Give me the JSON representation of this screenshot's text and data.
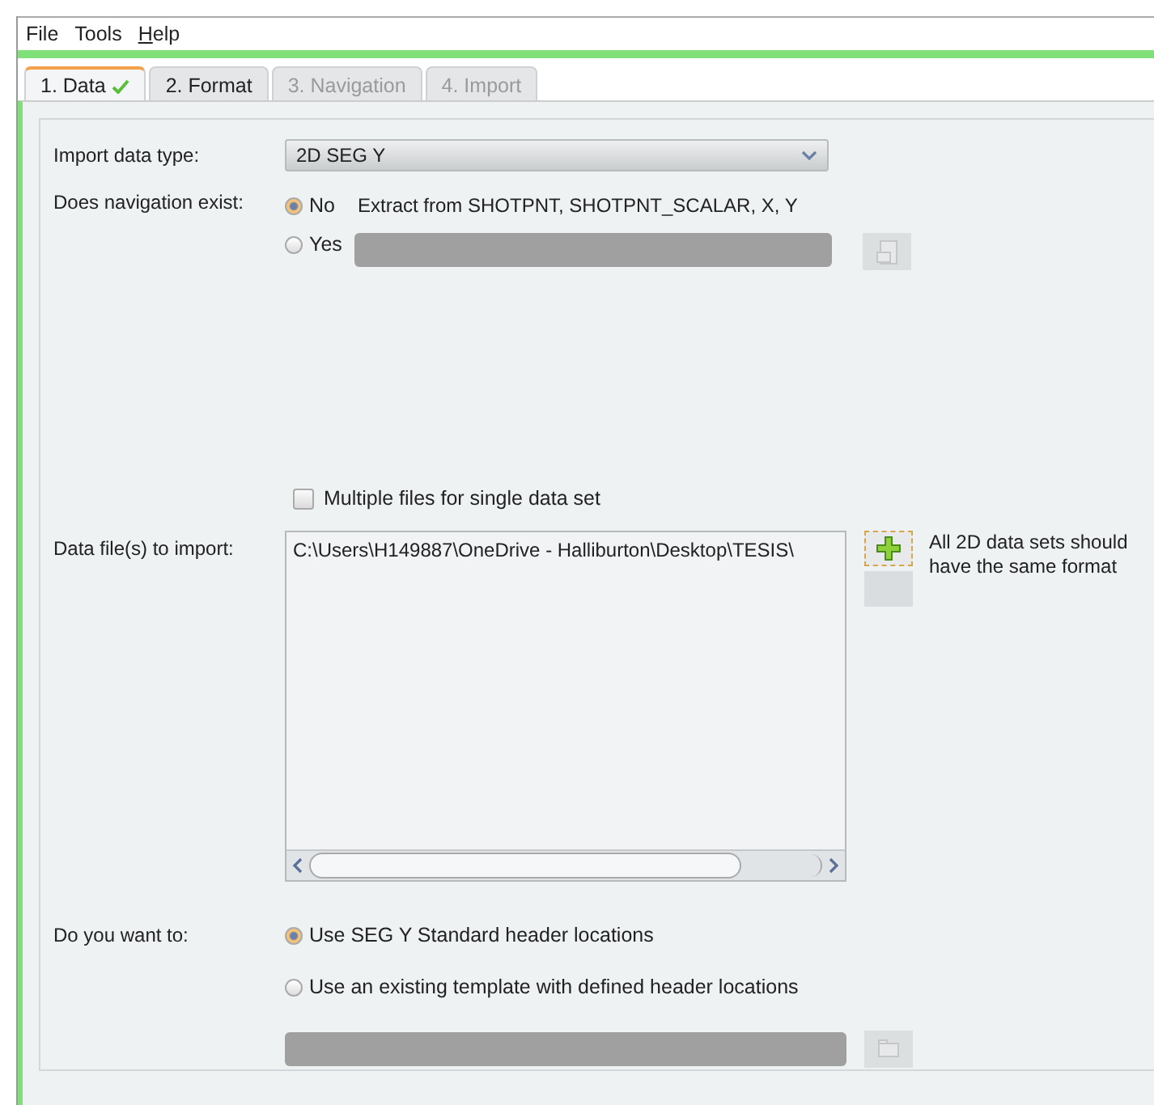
{
  "menu": [
    {
      "label": "File"
    },
    {
      "label": "Tools"
    },
    {
      "label": "Help",
      "underline_first": true
    }
  ],
  "tabs": [
    {
      "label": "1. Data",
      "selected": true,
      "disabled": false,
      "done": true
    },
    {
      "label": "2. Format",
      "selected": false,
      "disabled": false,
      "done": false
    },
    {
      "label": "3. Navigation",
      "selected": false,
      "disabled": true,
      "done": false
    },
    {
      "label": "4. Import",
      "selected": false,
      "disabled": true,
      "done": false
    }
  ],
  "import_type": {
    "label": "Import data type:",
    "value": "2D SEG Y"
  },
  "navigation": {
    "label": "Does navigation exist:",
    "options": [
      {
        "label": "No",
        "selected": true,
        "note": "Extract from SHOTPNT, SHOTPNT_SCALAR, X, Y"
      },
      {
        "label": "Yes",
        "selected": false
      }
    ]
  },
  "multiple_files": {
    "label": "Multiple files for single data set",
    "checked": false
  },
  "data_files": {
    "label": "Data file(s) to import:",
    "files": [
      "C:\\Users\\H149887\\OneDrive - Halliburton\\Desktop\\TESIS\\"
    ],
    "hint": "All 2D data sets should have the same format"
  },
  "headers": {
    "label": "Do you want to:",
    "options": [
      {
        "label": "Use SEG Y Standard header locations",
        "selected": true
      },
      {
        "label": "Use an existing template with defined header locations",
        "selected": false
      }
    ]
  }
}
